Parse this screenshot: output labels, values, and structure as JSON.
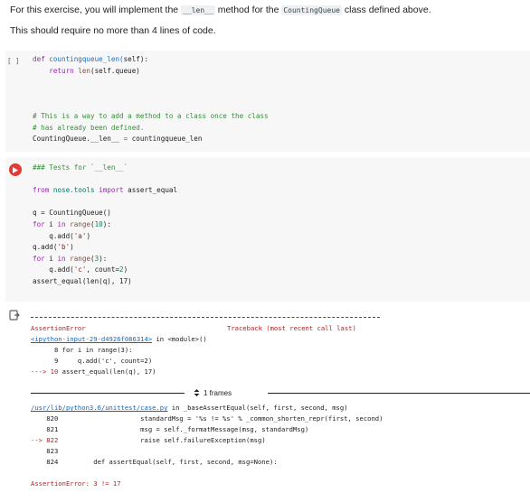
{
  "intro": {
    "line1_before": "For this exercise, you will implement the ",
    "line1_method": "__len__",
    "line1_middle": " method for the ",
    "line1_class": "CountingQueue",
    "line1_after": " class defined above.",
    "line2": "This should require no more than 4 lines of code."
  },
  "cell1": {
    "exec_count": "[ ]",
    "lines": {
      "l1_def": "def",
      "l1_name": " countingqueue_len(",
      "l1_self": "self",
      "l1_end": "):",
      "l2_return": "    return",
      "l2_len": " len",
      "l2_rest": "(self.queue)",
      "l3_comment": "# This is a way to add a method to a class once the class",
      "l4_comment": "# has already been defined.",
      "l5_left": "CountingQueue.__len__",
      "l5_eq": " = ",
      "l5_right": "countingqueue_len"
    }
  },
  "cell2": {
    "lines": {
      "l1": "### Tests for `__len__`",
      "l2_from": "from",
      "l2_mod": " nose.tools ",
      "l2_import": "import",
      "l2_name": " assert_equal",
      "l3_a": "q = CountingQueue()",
      "l4_for": "for",
      "l4_i": " i ",
      "l4_in": "in",
      "l4_range": " range",
      "l4_open": "(",
      "l4_num": "10",
      "l4_close": "):",
      "l5_a": "    q.add(",
      "l5_s": "'a'",
      "l5_c": ")",
      "l6_a": "q.add(",
      "l6_s": "'b'",
      "l6_c": ")",
      "l7_for": "for",
      "l7_i": " i ",
      "l7_in": "in",
      "l7_range": " range",
      "l7_open": "(",
      "l7_num": "3",
      "l7_close": "):",
      "l8_a": "    q.add(",
      "l8_s": "'c'",
      "l8_b": ", count=",
      "l8_num": "2",
      "l8_c": ")",
      "l9": "assert_equal(len(q), 17)"
    }
  },
  "output": {
    "err_name": "AssertionError",
    "traceback_label": "Traceback (most recent call last)",
    "input_link": "<ipython-input-29-d4926f086314>",
    "in_module": " in <module>()",
    "t1": "      8 for i in range(3):",
    "t2": "      9     q.add('c', count=2)",
    "t3_arrow": "---> 10 ",
    "t3_rest": "assert_equal(len(q), 17)",
    "frames_label": "1 frames",
    "case_link": "/usr/lib/python3.6/unittest/case.py",
    "case_in": " in _baseAssertEqual(self, first, second, msg)",
    "c1": "    820                     standardMsg = '%s != %s' % _common_shorten_repr(first, second)",
    "c2": "    821                     msg = self._formatMessage(msg, standardMsg)",
    "c3_arrow": "--> 822",
    "c3_rest": "                     raise self.failureException(msg)",
    "c4": "    823",
    "c5": "    824         def assertEqual(self, first, second, msg=None):",
    "final_error": "AssertionError: 3 != 17"
  }
}
